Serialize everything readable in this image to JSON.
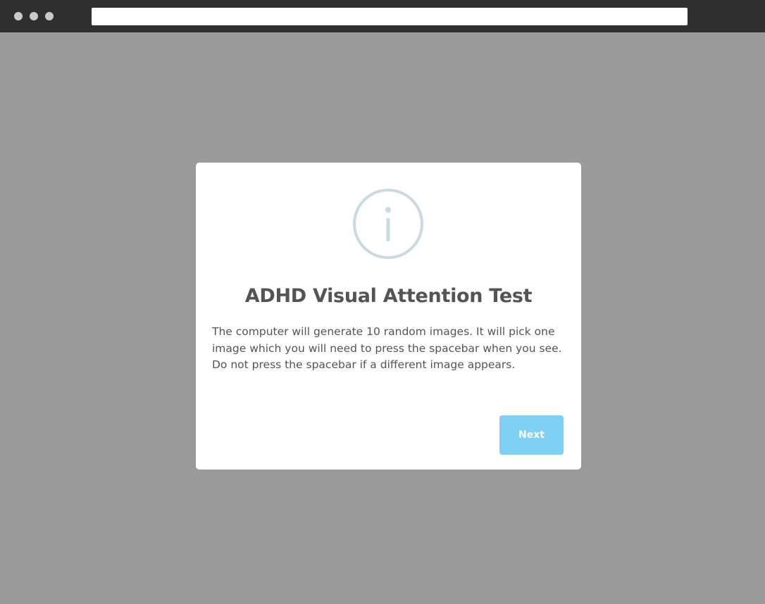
{
  "browser": {
    "address_value": ""
  },
  "modal": {
    "icon": "info-circle-icon",
    "title": "ADHD Visual Attention Test",
    "body": "The computer will generate 10 random images. It will pick one image which you will need to press the spacebar when you see. Do not press the spacebar if a different image appears.",
    "next_label": "Next"
  },
  "colors": {
    "browser_bar": "#2f2f2f",
    "overlay": "#9a9a9a",
    "modal_background": "#ffffff",
    "icon_stroke": "#c9dae1",
    "title_text": "#545454",
    "button": "#7fd0f2",
    "button_text": "#ffffff"
  }
}
